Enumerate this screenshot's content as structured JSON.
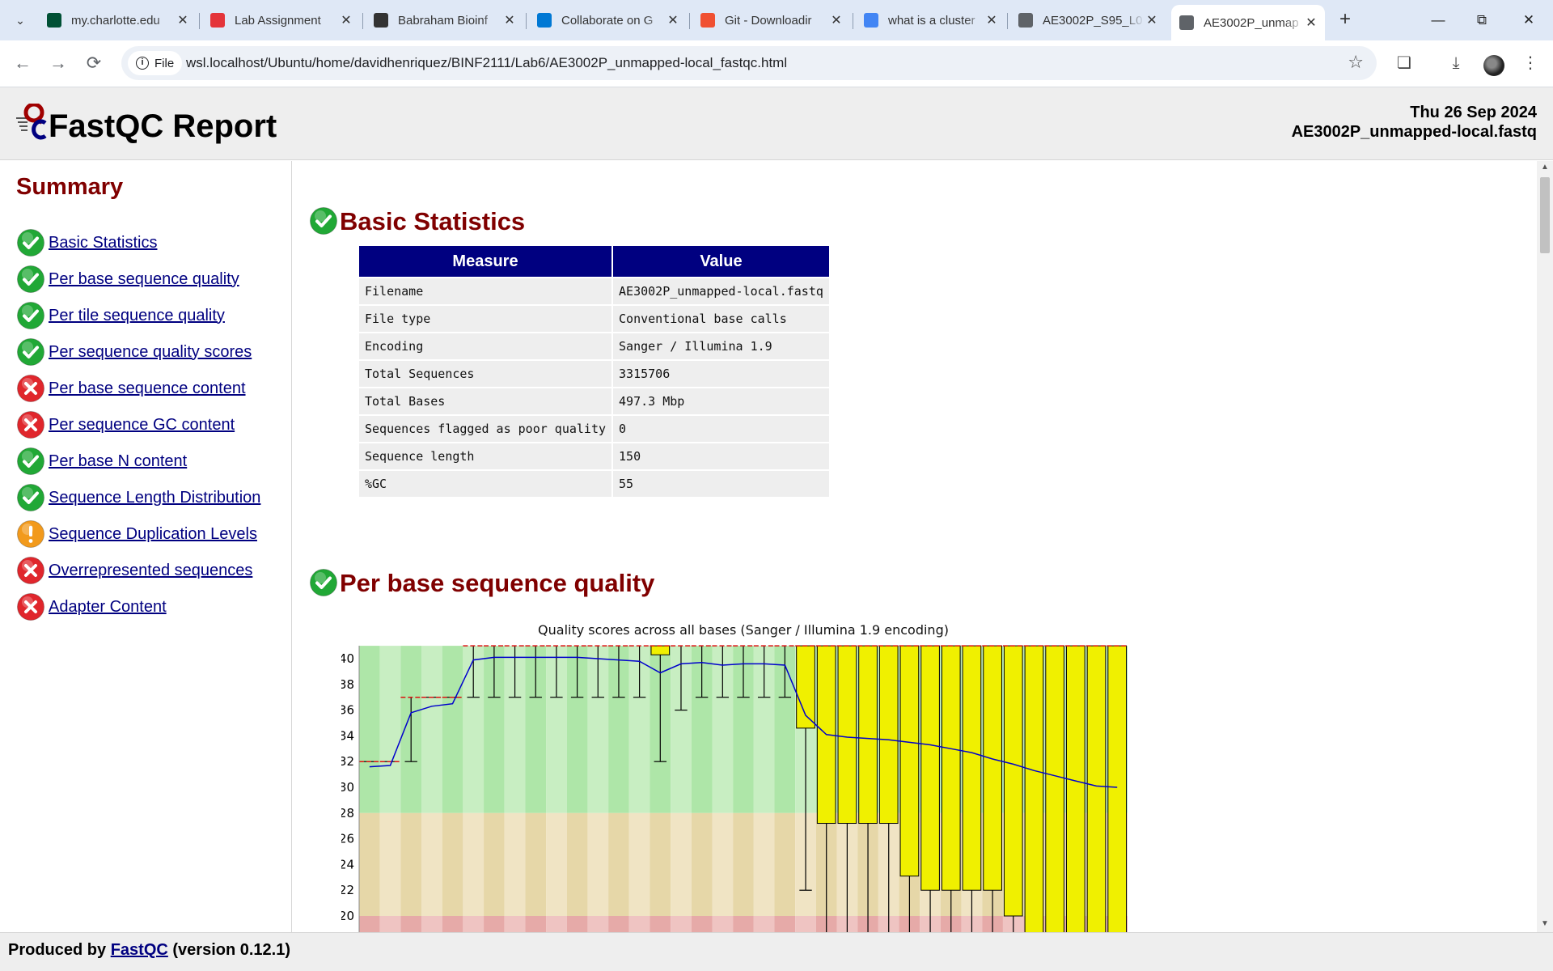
{
  "browser": {
    "tabs": [
      {
        "label": "my.charlotte.edu",
        "icon": "charlotte-favicon",
        "color": "#005035",
        "active": false
      },
      {
        "label": "Lab Assignment",
        "icon": "canvas-favicon",
        "color": "#e4343a",
        "active": false
      },
      {
        "label": "Babraham Bioinf",
        "icon": "babraham-favicon",
        "color": "#333333",
        "active": false
      },
      {
        "label": "Collaborate on G",
        "icon": "vscode-favicon",
        "color": "#0078d4",
        "active": false
      },
      {
        "label": "Git - Downloadir",
        "icon": "git-favicon",
        "color": "#f05032",
        "active": false
      },
      {
        "label": "what is a cluster",
        "icon": "google-favicon",
        "color": "#4285f4",
        "active": false
      },
      {
        "label": "AE3002P_S95_L0",
        "icon": "globe-favicon",
        "color": "#5f6368",
        "active": false
      },
      {
        "label": "AE3002P_unmap",
        "icon": "globe-favicon",
        "color": "#5f6368",
        "active": true
      }
    ],
    "site_chip": "File",
    "url": "wsl.localhost/Ubuntu/home/davidhenriquez/BINF2111/Lab6/AE3002P_unmapped-local_fastqc.html"
  },
  "report": {
    "title": "FastQC Report",
    "date": "Thu 26 Sep 2024",
    "filename": "AE3002P_unmapped-local.fastq"
  },
  "summary": {
    "title": "Summary",
    "items": [
      {
        "label": "Basic Statistics",
        "status": "pass"
      },
      {
        "label": "Per base sequence quality",
        "status": "pass"
      },
      {
        "label": "Per tile sequence quality",
        "status": "pass"
      },
      {
        "label": "Per sequence quality scores",
        "status": "pass"
      },
      {
        "label": "Per base sequence content",
        "status": "fail"
      },
      {
        "label": "Per sequence GC content",
        "status": "fail"
      },
      {
        "label": "Per base N content",
        "status": "pass"
      },
      {
        "label": "Sequence Length Distribution",
        "status": "pass"
      },
      {
        "label": "Sequence Duplication Levels",
        "status": "warn"
      },
      {
        "label": "Overrepresented sequences",
        "status": "fail"
      },
      {
        "label": "Adapter Content",
        "status": "fail"
      }
    ]
  },
  "basic_stats": {
    "heading": "Basic Statistics",
    "headers": [
      "Measure",
      "Value"
    ],
    "rows": [
      [
        "Filename",
        "AE3002P_unmapped-local.fastq"
      ],
      [
        "File type",
        "Conventional base calls"
      ],
      [
        "Encoding",
        "Sanger / Illumina 1.9"
      ],
      [
        "Total Sequences",
        "3315706"
      ],
      [
        "Total Bases",
        "497.3 Mbp"
      ],
      [
        "Sequences flagged as poor quality",
        "0"
      ],
      [
        "Sequence length",
        "150"
      ],
      [
        "%GC",
        "55"
      ]
    ]
  },
  "quality_section": {
    "heading": "Per base sequence quality"
  },
  "chart_data": {
    "type": "box",
    "title": "Quality scores across all bases (Sanger / Illumina 1.9 encoding)",
    "y_ticks": [
      20,
      22,
      24,
      26,
      28,
      30,
      32,
      34,
      36,
      38,
      40
    ],
    "ylim_visible": [
      19.5,
      41
    ],
    "zones": [
      {
        "from": 28,
        "to": 41,
        "color": "#aee6a8",
        "alt": "#c8eec2"
      },
      {
        "from": 20,
        "to": 28,
        "color": "#e6d7a8",
        "alt": "#f0e4c4"
      },
      {
        "from": 0,
        "to": 20,
        "color": "#e6aaa8",
        "alt": "#efc4c2"
      }
    ],
    "series": [
      {
        "name": "mean",
        "color": "#0000cc"
      }
    ],
    "boxes": [
      {
        "pos": 1,
        "q1": 32,
        "q3": 32,
        "med": 32,
        "lo": 32,
        "hi": 32,
        "mean": 31.6
      },
      {
        "pos": 2,
        "q1": 32,
        "q3": 32,
        "med": 32,
        "lo": 32,
        "hi": 32,
        "mean": 31.7
      },
      {
        "pos": 3,
        "q1": 37,
        "q3": 37,
        "med": 37,
        "lo": 32,
        "hi": 37,
        "mean": 35.8
      },
      {
        "pos": 4,
        "q1": 37,
        "q3": 37,
        "med": 37,
        "lo": 37,
        "hi": 37,
        "mean": 36.3
      },
      {
        "pos": 5,
        "q1": 37,
        "q3": 37,
        "med": 37,
        "lo": 37,
        "hi": 37,
        "mean": 36.5
      },
      {
        "pos": 6,
        "q1": 41,
        "q3": 41,
        "med": 41,
        "lo": 37,
        "hi": 41,
        "mean": 39.9
      },
      {
        "pos": 7,
        "q1": 41,
        "q3": 41,
        "med": 41,
        "lo": 37,
        "hi": 41,
        "mean": 40.1
      },
      {
        "pos": 8,
        "q1": 41,
        "q3": 41,
        "med": 41,
        "lo": 37,
        "hi": 41,
        "mean": 40.1
      },
      {
        "pos": 9,
        "q1": 41,
        "q3": 41,
        "med": 41,
        "lo": 37,
        "hi": 41,
        "mean": 40.1
      },
      {
        "pos": 10,
        "q1": 41,
        "q3": 41,
        "med": 41,
        "lo": 37,
        "hi": 41,
        "mean": 40.1
      },
      {
        "pos": 11,
        "q1": 41,
        "q3": 41,
        "med": 41,
        "lo": 37,
        "hi": 41,
        "mean": 40.1
      },
      {
        "pos": 12,
        "q1": 41,
        "q3": 41,
        "med": 41,
        "lo": 37,
        "hi": 41,
        "mean": 40.0
      },
      {
        "pos": 13,
        "q1": 41,
        "q3": 41,
        "med": 41,
        "lo": 37,
        "hi": 41,
        "mean": 39.9
      },
      {
        "pos": 14,
        "q1": 41,
        "q3": 41,
        "med": 41,
        "lo": 37,
        "hi": 41,
        "mean": 39.8
      },
      {
        "pos": 15,
        "q1": 40.3,
        "q3": 41,
        "med": 41,
        "lo": 32,
        "hi": 41,
        "mean": 38.9
      },
      {
        "pos": 16,
        "q1": 41,
        "q3": 41,
        "med": 41,
        "lo": 36,
        "hi": 41,
        "mean": 39.6
      },
      {
        "pos": 17,
        "q1": 41,
        "q3": 41,
        "med": 41,
        "lo": 37,
        "hi": 41,
        "mean": 39.7
      },
      {
        "pos": 18,
        "q1": 41,
        "q3": 41,
        "med": 41,
        "lo": 37,
        "hi": 41,
        "mean": 39.5
      },
      {
        "pos": 19,
        "q1": 41,
        "q3": 41,
        "med": 41,
        "lo": 37,
        "hi": 41,
        "mean": 39.6
      },
      {
        "pos": 20,
        "q1": 41,
        "q3": 41,
        "med": 41,
        "lo": 37,
        "hi": 41,
        "mean": 39.6
      },
      {
        "pos": 21,
        "q1": 41,
        "q3": 41,
        "med": 41,
        "lo": 37,
        "hi": 41,
        "mean": 39.5
      },
      {
        "pos": 22,
        "q1": 34.6,
        "q3": 41,
        "med": 41,
        "lo": 22,
        "hi": 41,
        "mean": 35.6
      },
      {
        "pos": 23,
        "q1": 27.2,
        "q3": 41,
        "med": 41,
        "lo": 12,
        "hi": 41,
        "mean": 34.1
      },
      {
        "pos": 24,
        "q1": 27.2,
        "q3": 41,
        "med": 41,
        "lo": 12,
        "hi": 41,
        "mean": 33.9
      },
      {
        "pos": 25,
        "q1": 27.2,
        "q3": 41,
        "med": 41,
        "lo": 12,
        "hi": 41,
        "mean": 33.8
      },
      {
        "pos": 26,
        "q1": 27.2,
        "q3": 41,
        "med": 41,
        "lo": 12,
        "hi": 41,
        "mean": 33.7
      },
      {
        "pos": 27,
        "q1": 23.1,
        "q3": 41,
        "med": 41,
        "lo": 12,
        "hi": 41,
        "mean": 33.5
      },
      {
        "pos": 28,
        "q1": 22,
        "q3": 41,
        "med": 41,
        "lo": 12,
        "hi": 41,
        "mean": 33.3
      },
      {
        "pos": 29,
        "q1": 22,
        "q3": 41,
        "med": 41,
        "lo": 12,
        "hi": 41,
        "mean": 33.0
      },
      {
        "pos": 30,
        "q1": 22,
        "q3": 41,
        "med": 41,
        "lo": 12,
        "hi": 41,
        "mean": 32.7
      },
      {
        "pos": 31,
        "q1": 22,
        "q3": 41,
        "med": 41,
        "lo": 12,
        "hi": 41,
        "mean": 32.2
      },
      {
        "pos": 32,
        "q1": 20,
        "q3": 41,
        "med": 41,
        "lo": 12,
        "hi": 41,
        "mean": 31.8
      },
      {
        "pos": 33,
        "q1": 18,
        "q3": 41,
        "med": 41,
        "lo": 12,
        "hi": 41,
        "mean": 31.3
      },
      {
        "pos": 34,
        "q1": 18,
        "q3": 41,
        "med": 41,
        "lo": 12,
        "hi": 41,
        "mean": 30.9
      },
      {
        "pos": 35,
        "q1": 18,
        "q3": 41,
        "med": 41,
        "lo": 12,
        "hi": 41,
        "mean": 30.5
      },
      {
        "pos": 36,
        "q1": 18,
        "q3": 41,
        "med": 41,
        "lo": 12,
        "hi": 41,
        "mean": 30.1
      },
      {
        "pos": 37,
        "q1": 18,
        "q3": 41,
        "med": 41,
        "lo": 12,
        "hi": 41,
        "mean": 30.0
      }
    ]
  },
  "footer": {
    "prefix": "Produced by ",
    "link": "FastQC",
    "suffix": " (version 0.12.1)"
  }
}
